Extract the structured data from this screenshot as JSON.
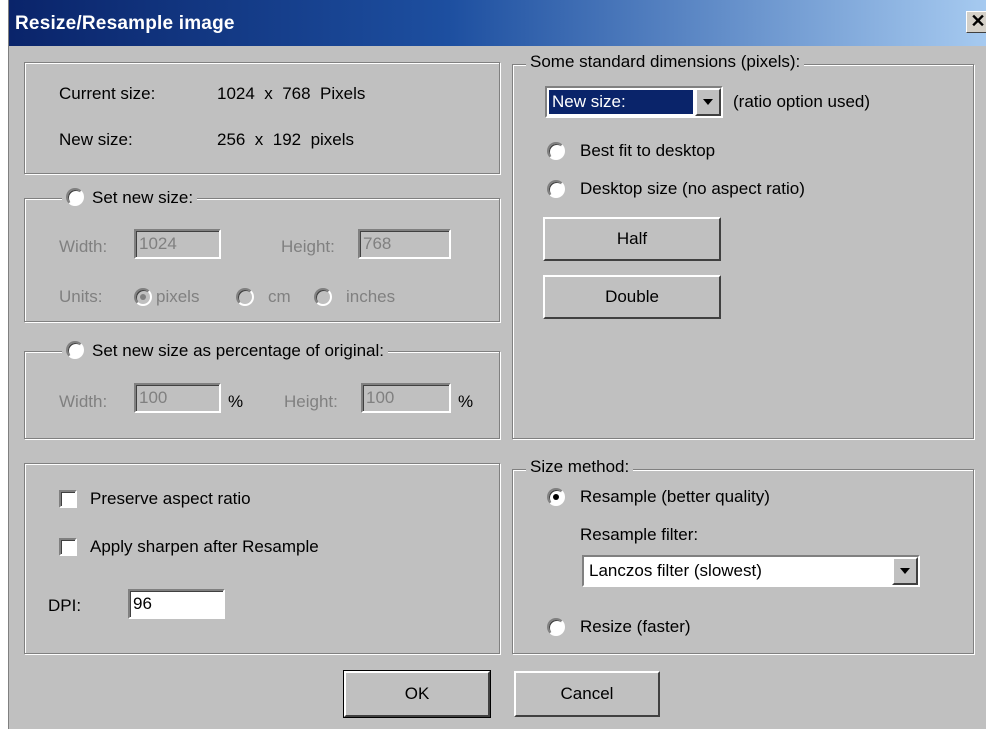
{
  "window": {
    "title": "Resize/Resample image",
    "close_glyph": "✕"
  },
  "size_info": {
    "current_label": "Current size:",
    "current_value": "1024  x  768  Pixels",
    "new_label": "New size:",
    "new_value": "256  x  192  pixels"
  },
  "set_new_size": {
    "label": "Set new size:",
    "width_label": "Width:",
    "width_value": "1024",
    "height_label": "Height:",
    "height_value": "768",
    "units_label": "Units:",
    "units": [
      "pixels",
      "cm",
      "inches"
    ],
    "selected_unit": "pixels"
  },
  "percentage": {
    "label": "Set new size as percentage of original:",
    "width_label": "Width:",
    "width_value": "100",
    "height_label": "Height:",
    "height_value": "100",
    "unit": "%"
  },
  "options": {
    "preserve_aspect": "Preserve aspect ratio",
    "apply_sharpen": "Apply sharpen after Resample",
    "dpi_label": "DPI:",
    "dpi_value": "96"
  },
  "standard": {
    "legend": "Some standard dimensions (pixels):",
    "dropdown_value": "New size:",
    "ratio_note": "(ratio option used)",
    "best_fit": "Best fit to desktop",
    "desktop_size": "Desktop size (no aspect ratio)",
    "half_button": "Half",
    "double_button": "Double"
  },
  "size_method": {
    "legend": "Size method:",
    "resample": "Resample (better quality)",
    "filter_label": "Resample filter:",
    "filter_value": "Lanczos filter (slowest)",
    "resize": "Resize (faster)",
    "selected": "resample"
  },
  "buttons": {
    "ok": "OK",
    "cancel": "Cancel"
  }
}
